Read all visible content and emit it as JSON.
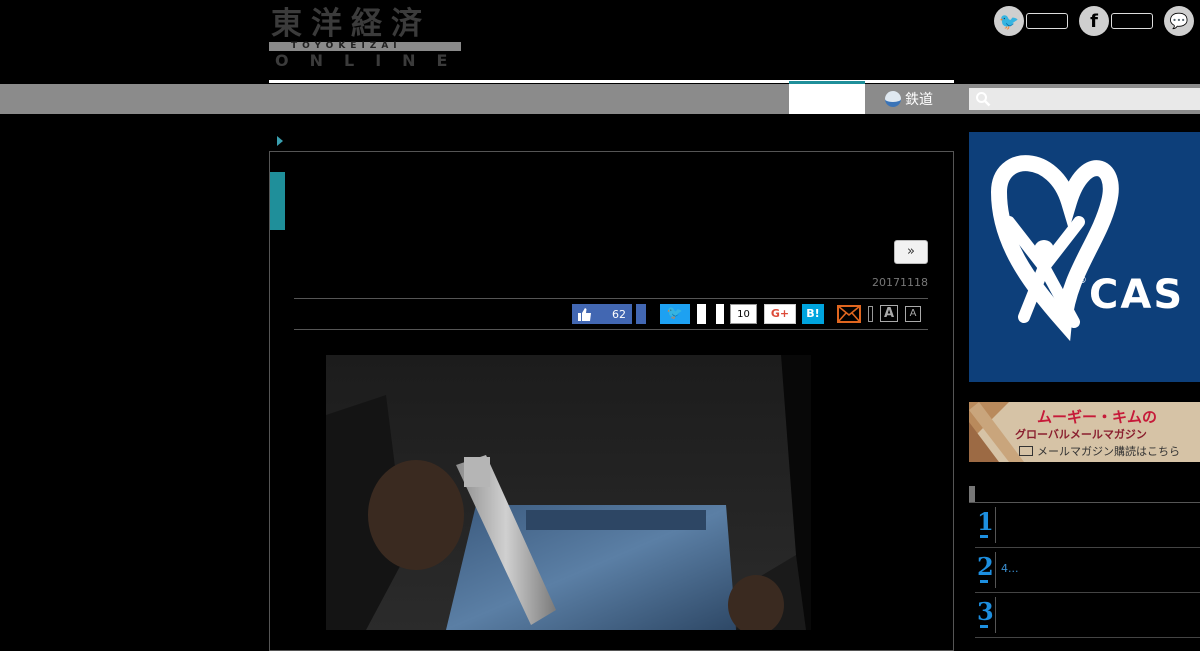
{
  "header": {
    "logo_kanji": "東洋経済",
    "logo_roman": "TOYOKEIZAI",
    "logo_online": "ONLINE",
    "social": [
      {
        "name": "twitter",
        "glyph": "🐦"
      },
      {
        "name": "facebook",
        "glyph": "f"
      },
      {
        "name": "messenger",
        "glyph": "💬"
      }
    ]
  },
  "nav": {
    "items": [
      {
        "label": "",
        "active": true
      },
      {
        "label": "鉄道",
        "icon": "train-icon"
      }
    ],
    "search_placeholder": ""
  },
  "article": {
    "next_label": "»",
    "date": "20171118",
    "share": {
      "like_count": "62",
      "tweet_glyph": "🐦",
      "hatena_count": "10",
      "gplus_label": "G+",
      "hatena_label": "B!",
      "font_large": "A",
      "font_small": "A"
    }
  },
  "sidebar": {
    "ad1": {
      "brand": "CAS",
      "reg": "®",
      "bg": "#0d3f7a"
    },
    "ad2": {
      "line1": "ムーギー・キムの",
      "line2": "グローバルメールマガジン",
      "line3": "メールマガジン購読はこちら"
    },
    "ranking": [
      {
        "num": "1",
        "text": ""
      },
      {
        "num": "2",
        "text": "4..."
      },
      {
        "num": "3",
        "text": ""
      }
    ]
  },
  "colors": {
    "accent": "#1f8f9a",
    "nav": "#8b8b8b",
    "facebook": "#4267b2",
    "twitter": "#1da1f2",
    "hatena": "#00a4de"
  }
}
